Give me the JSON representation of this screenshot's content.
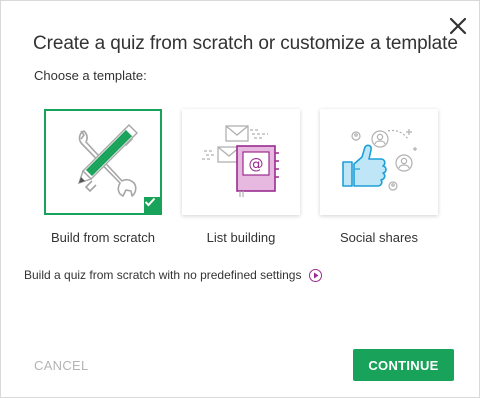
{
  "dialog": {
    "title": "Create a quiz from scratch or customize a template",
    "subtitle": "Choose a template:",
    "close_icon": "close-icon"
  },
  "templates": [
    {
      "label": "Build from scratch",
      "icon": "pencil-wrench-icon",
      "selected": true
    },
    {
      "label": "List building",
      "icon": "email-list-icon",
      "selected": false
    },
    {
      "label": "Social shares",
      "icon": "thumbs-up-social-icon",
      "selected": false
    }
  ],
  "description": "Build a quiz from scratch with no predefined settings",
  "actions": {
    "cancel_label": "CANCEL",
    "continue_label": "CONTINUE"
  },
  "colors": {
    "accent_green": "#19a35a",
    "accent_purple": "#9b2c8f",
    "accent_blue": "#1e9fd8"
  }
}
